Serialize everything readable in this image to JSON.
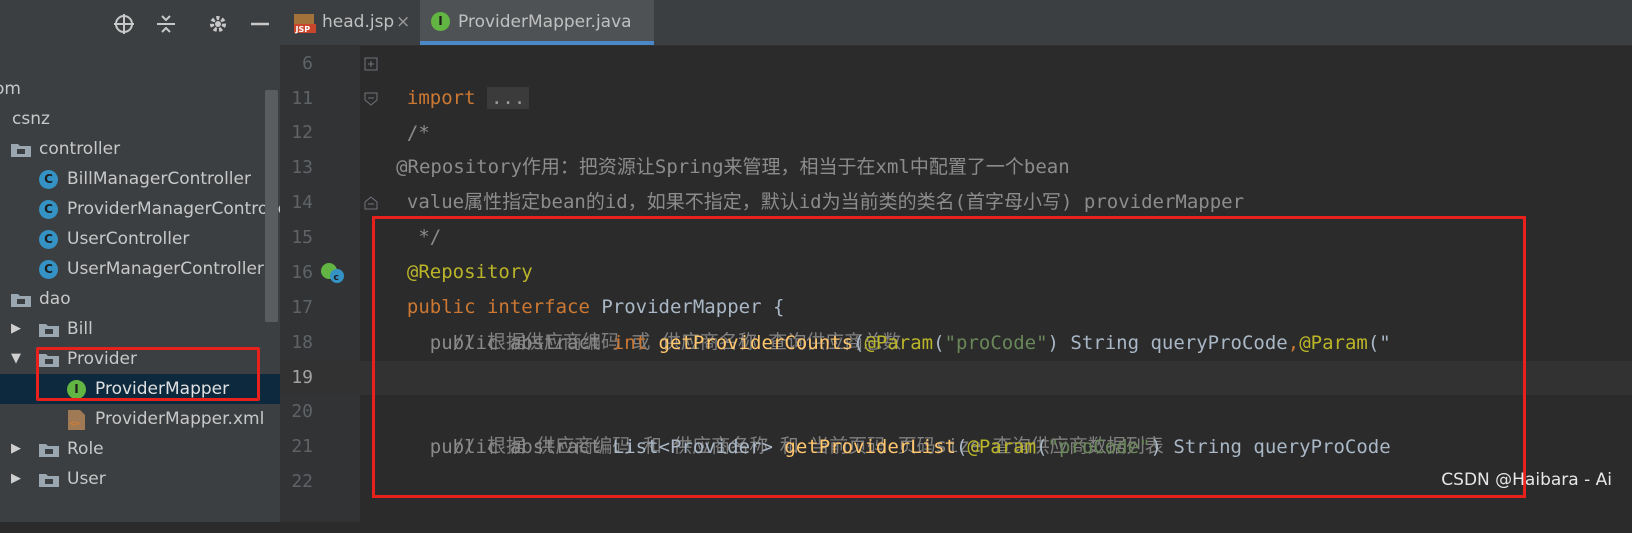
{
  "sidebar": {
    "toolbar_icons": [
      "locate-icon",
      "collapse-all-icon",
      "gear-icon",
      "minimize-icon"
    ],
    "tree": [
      {
        "label": "om",
        "type": "text"
      },
      {
        "label": "csnz",
        "type": "package"
      },
      {
        "label": "controller",
        "type": "package"
      },
      {
        "label": "BillManagerController",
        "type": "class"
      },
      {
        "label": "ProviderManagerController",
        "type": "class"
      },
      {
        "label": "UserController",
        "type": "class"
      },
      {
        "label": "UserManagerController",
        "type": "class"
      },
      {
        "label": "dao",
        "type": "package"
      },
      {
        "label": "Bill",
        "type": "folder",
        "expanded": false
      },
      {
        "label": "Provider",
        "type": "folder",
        "expanded": true
      },
      {
        "label": "ProviderMapper",
        "type": "interface",
        "selected": true
      },
      {
        "label": "ProviderMapper.xml",
        "type": "xml"
      },
      {
        "label": "Role",
        "type": "folder",
        "expanded": false
      },
      {
        "label": "User",
        "type": "folder",
        "expanded": false
      }
    ]
  },
  "tabs": [
    {
      "label": "head.jsp",
      "icon": "jsp-file-icon",
      "icon_text": "JSP",
      "active": false
    },
    {
      "label": "ProviderMapper.java",
      "icon": "interface-icon",
      "icon_text": "I",
      "active": true
    }
  ],
  "editor": {
    "line_numbers": [
      "6",
      "11",
      "12",
      "13",
      "14",
      "15",
      "16",
      "17",
      "18",
      "19",
      "20",
      "21",
      "22"
    ],
    "lines": [
      {
        "import_kw": "import",
        "collapsed": "..."
      },
      {
        "text": "/*"
      },
      {
        "text": "@Repository作用：把资源让Spring来管理，相当于在xml中配置了一个bean"
      },
      {
        "text": "value属性指定bean的id，如果不指定，默认id为当前类的类名(首字母小写) providerMapper"
      },
      {
        "text": " */"
      },
      {
        "text": "@Repository"
      },
      {
        "kw": "public interface",
        "name": " ProviderMapper {"
      },
      {
        "text": "    // 根据供应商编码 或 供应商名称 查询供应商总数"
      },
      {
        "p1": "    public abstract ",
        "kw": "int ",
        "fn": "getProviderCounts",
        "p2": "(",
        "ann": "@Param",
        "p3": "(",
        "str": "\"proCode\"",
        "p4": ") String queryProCode",
        "comma": ",",
        "ann2": "@Param",
        "p5": "(\""
      },
      {
        "text": ""
      },
      {
        "text": "    // 根据 供应商编码 和 供应商名称 和 当前页码 页码size 查询供应商数据列表"
      },
      {
        "p1": "    public abstract ",
        "plain": "List<Provider> ",
        "fn": "getProviderList",
        "p2": "(",
        "ann": "@Param",
        "p3": "(",
        "str": "\"proCode\"",
        "p4": ") String queryProCode"
      },
      {
        "text": ""
      }
    ]
  },
  "watermark": "CSDN @Haibara - Ai",
  "colors": {
    "highlight_box": "#e8211d",
    "keyword": "#cc7832",
    "annotation": "#bbb529",
    "string": "#6a8759",
    "method": "#ffc66d",
    "comment": "#808080"
  }
}
